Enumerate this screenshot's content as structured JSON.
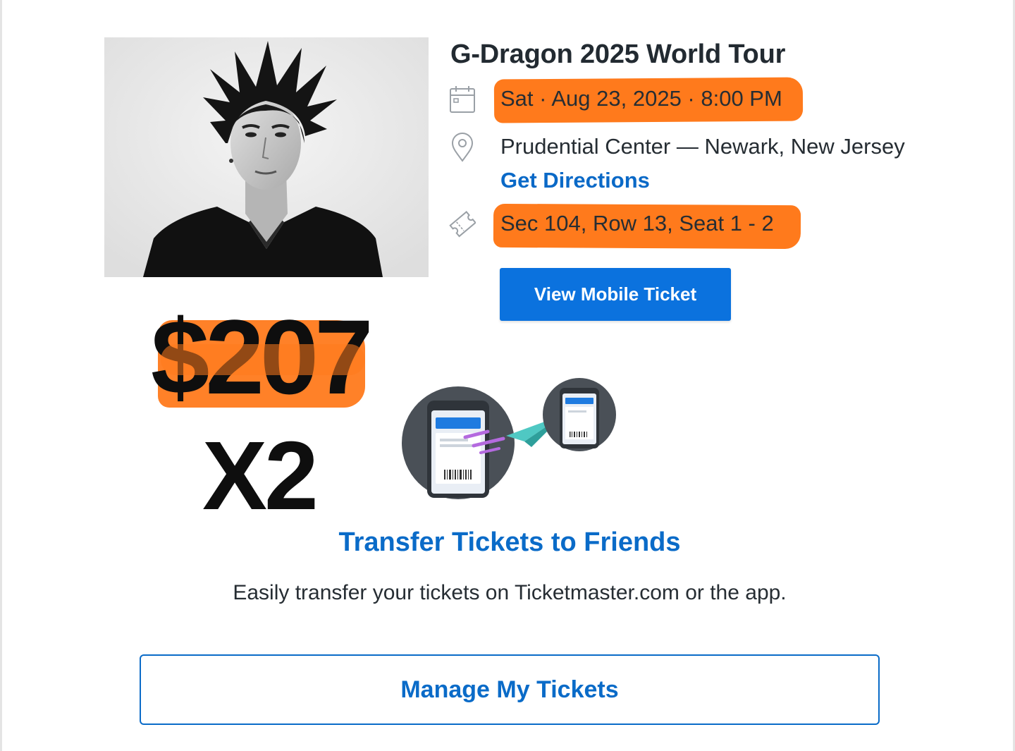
{
  "event": {
    "title": "G-Dragon 2025 World Tour",
    "date_time": "Sat · Aug 23, 2025 · 8:00 PM",
    "venue": "Prudential Center — Newark, New Jersey",
    "directions_label": "Get Directions",
    "seats": "Sec 104, Row 13, Seat 1 - 2",
    "mobile_ticket_label": "View Mobile Ticket"
  },
  "overlay": {
    "price": "$207",
    "quantity": "X2",
    "highlight_color": "#ff7a1c"
  },
  "transfer": {
    "heading": "Transfer Tickets to Friends",
    "subtext": "Easily transfer your tickets on Ticketmaster.com or the app.",
    "manage_label": "Manage My Tickets"
  },
  "icons": {
    "date": "calendar-icon",
    "venue": "map-pin-icon",
    "seats": "ticket-icon"
  },
  "colors": {
    "brand_blue": "#0b72de",
    "link_blue": "#0a6bc8"
  }
}
